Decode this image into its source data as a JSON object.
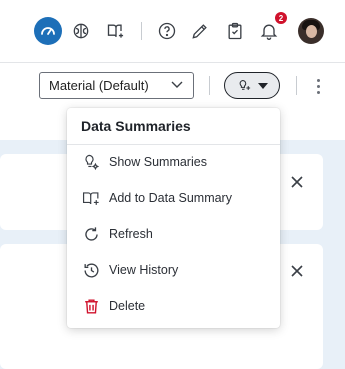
{
  "header": {
    "notification_count": "2",
    "icons": [
      "dashboard-icon",
      "brain-icon",
      "book-sparkle-icon",
      "help-icon",
      "pencil-icon",
      "clipboard-check-icon",
      "bell-icon"
    ]
  },
  "toolbar": {
    "theme_select_value": "Material (Default)"
  },
  "menu": {
    "title": "Data Summaries",
    "items": [
      {
        "label": "Show Summaries",
        "icon": "summary-sparkle-icon"
      },
      {
        "label": "Add to Data Summary",
        "icon": "book-add-icon"
      },
      {
        "label": "Refresh",
        "icon": "refresh-icon"
      },
      {
        "label": "View History",
        "icon": "history-icon"
      },
      {
        "label": "Delete",
        "icon": "trash-icon",
        "color": "#d0122c"
      }
    ]
  },
  "colors": {
    "accent": "#1d6fb8",
    "danger": "#d0122c",
    "canvas_bg": "#e8f0f8"
  }
}
